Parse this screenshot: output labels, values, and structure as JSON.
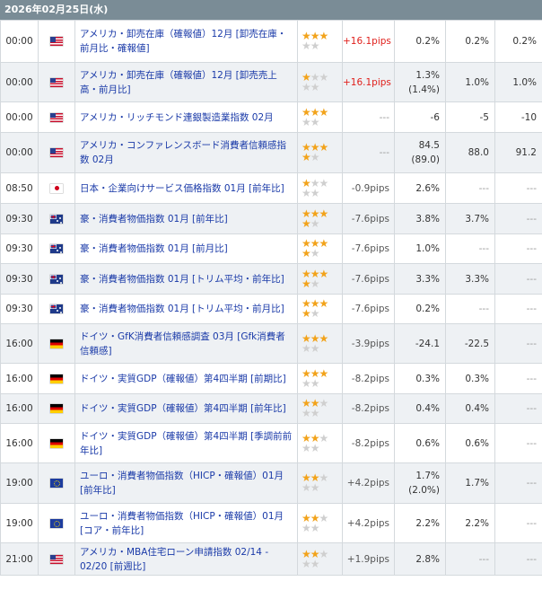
{
  "header": {
    "date": "2026年02月25日(水)"
  },
  "rows": [
    {
      "time": "00:00",
      "country": "us",
      "flag_icon": "us-flag-icon",
      "name": "アメリカ・卸売在庫（確報値）12月 [卸売在庫・前月比・確報値]",
      "stars": 3,
      "pips": "+16.1pips",
      "pips_color": "pos",
      "result": "0.2%",
      "result_sub": "",
      "forecast": "0.2%",
      "previous": "0.2%"
    },
    {
      "time": "00:00",
      "country": "us",
      "flag_icon": "us-flag-icon",
      "name": "アメリカ・卸売在庫（確報値）12月 [卸売売上高・前月比]",
      "stars": 1,
      "pips": "+16.1pips",
      "pips_color": "pos",
      "result": "1.3%",
      "result_sub": "(1.4%)",
      "forecast": "1.0%",
      "previous": "1.0%"
    },
    {
      "time": "00:00",
      "country": "us",
      "flag_icon": "us-flag-icon",
      "name": "アメリカ・リッチモンド連銀製造業指数 02月",
      "stars": 3,
      "pips": "---",
      "pips_color": "na",
      "result": "-6",
      "result_sub": "",
      "forecast": "-5",
      "previous": "-10"
    },
    {
      "time": "00:00",
      "country": "us",
      "flag_icon": "us-flag-icon",
      "name": "アメリカ・コンファレンスボード消費者信頼感指数 02月",
      "stars": 4,
      "pips": "---",
      "pips_color": "na",
      "result": "84.5",
      "result_sub": "(89.0)",
      "forecast": "88.0",
      "previous": "91.2"
    },
    {
      "time": "08:50",
      "country": "jp",
      "flag_icon": "japan-flag-icon",
      "name": "日本・企業向けサービス価格指数 01月 [前年比]",
      "stars": 1,
      "pips": "-0.9pips",
      "pips_color": "neg",
      "result": "2.6%",
      "result_sub": "",
      "forecast": "---",
      "previous": "---"
    },
    {
      "time": "09:30",
      "country": "au",
      "flag_icon": "australia-flag-icon",
      "name": "豪・消費者物価指数 01月 [前年比]",
      "stars": 4,
      "pips": "-7.6pips",
      "pips_color": "neg",
      "result": "3.8%",
      "result_sub": "",
      "forecast": "3.7%",
      "previous": "---"
    },
    {
      "time": "09:30",
      "country": "au",
      "flag_icon": "australia-flag-icon",
      "name": "豪・消費者物価指数 01月 [前月比]",
      "stars": 4,
      "pips": "-7.6pips",
      "pips_color": "neg",
      "result": "1.0%",
      "result_sub": "",
      "forecast": "---",
      "previous": "---"
    },
    {
      "time": "09:30",
      "country": "au",
      "flag_icon": "australia-flag-icon",
      "name": "豪・消費者物価指数 01月 [トリム平均・前年比]",
      "stars": 4,
      "pips": "-7.6pips",
      "pips_color": "neg",
      "result": "3.3%",
      "result_sub": "",
      "forecast": "3.3%",
      "previous": "---"
    },
    {
      "time": "09:30",
      "country": "au",
      "flag_icon": "australia-flag-icon",
      "name": "豪・消費者物価指数 01月 [トリム平均・前月比]",
      "stars": 4,
      "pips": "-7.6pips",
      "pips_color": "neg",
      "result": "0.2%",
      "result_sub": "",
      "forecast": "---",
      "previous": "---"
    },
    {
      "time": "16:00",
      "country": "de",
      "flag_icon": "germany-flag-icon",
      "name": "ドイツ・GfK消費者信頼感調査 03月 [Gfk消費者信頼感]",
      "stars": 3,
      "pips": "-3.9pips",
      "pips_color": "neg",
      "result": "-24.1",
      "result_sub": "",
      "forecast": "-22.5",
      "previous": "---"
    },
    {
      "time": "16:00",
      "country": "de",
      "flag_icon": "germany-flag-icon",
      "name": "ドイツ・実質GDP（確報値）第4四半期 [前期比]",
      "stars": 3,
      "pips": "-8.2pips",
      "pips_color": "neg",
      "result": "0.3%",
      "result_sub": "",
      "forecast": "0.3%",
      "previous": "---"
    },
    {
      "time": "16:00",
      "country": "de",
      "flag_icon": "germany-flag-icon",
      "name": "ドイツ・実質GDP（確報値）第4四半期 [前年比]",
      "stars": 2,
      "pips": "-8.2pips",
      "pips_color": "neg",
      "result": "0.4%",
      "result_sub": "",
      "forecast": "0.4%",
      "previous": "---"
    },
    {
      "time": "16:00",
      "country": "de",
      "flag_icon": "germany-flag-icon",
      "name": "ドイツ・実質GDP（確報値）第4四半期 [季調前前年比]",
      "stars": 2,
      "pips": "-8.2pips",
      "pips_color": "neg",
      "result": "0.6%",
      "result_sub": "",
      "forecast": "0.6%",
      "previous": "---"
    },
    {
      "time": "19:00",
      "country": "eu",
      "flag_icon": "eu-flag-icon",
      "name": "ユーロ・消費者物価指数（HICP・確報値）01月 [前年比]",
      "stars": 2,
      "pips": "+4.2pips",
      "pips_color": "neg",
      "result": "1.7%",
      "result_sub": "(2.0%)",
      "forecast": "1.7%",
      "previous": "---"
    },
    {
      "time": "19:00",
      "country": "eu",
      "flag_icon": "eu-flag-icon",
      "name": "ユーロ・消費者物価指数（HICP・確報値）01月 [コア・前年比]",
      "stars": 2,
      "pips": "+4.2pips",
      "pips_color": "neg",
      "result": "2.2%",
      "result_sub": "",
      "forecast": "2.2%",
      "previous": "---"
    },
    {
      "time": "21:00",
      "country": "us",
      "flag_icon": "us-flag-icon",
      "name": "アメリカ・MBA住宅ローン申請指数 02/14 - 02/20 [前週比]",
      "stars": 2,
      "pips": "+1.9pips",
      "pips_color": "neg",
      "result": "2.8%",
      "result_sub": "",
      "forecast": "---",
      "previous": "---"
    }
  ],
  "colors": {
    "header_bg": "#7a8c96",
    "link": "#1a3aa8",
    "star_on": "#f2a31b",
    "star_off": "#cfcfcf",
    "positive": "#e0201c"
  }
}
